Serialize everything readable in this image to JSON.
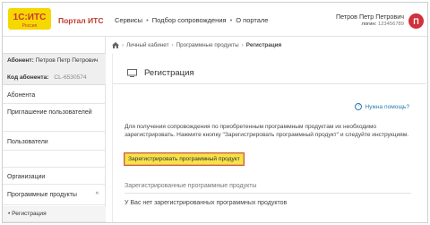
{
  "header": {
    "logo": {
      "brand_text": "1С:ИТС",
      "sub_text": "Россия"
    },
    "portal_title": "Портал ИТС",
    "nav": [
      "Сервисы",
      "Подбор сопровождения",
      "О портале"
    ],
    "user": {
      "name": "Петров Петр Петрович",
      "login_label": "логин:",
      "login_value": "123456789",
      "avatar_letter": "П"
    }
  },
  "sidebar": {
    "subscriber_label": "Абонент:",
    "subscriber_name": "Петров Петр Петрович",
    "code_label": "Код абонента:",
    "code_value": "CL-6530574",
    "items": [
      "Абонента",
      "Приглашение пользователей",
      "Пользователи",
      "Организации",
      "Программные продукты",
      "Регистрация"
    ]
  },
  "breadcrumb": {
    "items": [
      "Личный кабинет",
      "Программные продукты"
    ],
    "current": "Регистрация"
  },
  "main": {
    "title": "Регистрация",
    "help_link": "Нужна помощь?",
    "description": "Для получения сопровождения по приобретенным программным продуктам их необходимо зарегистрировать. Нажмите кнопку \"Зарегистрировать программный продукт\" и следуйте инструкциям.",
    "register_button": "Зарегистрировать программный продукт",
    "section_title": "Зарегистрированные программные продукты",
    "empty_message": "У Вас нет зарегистрированных программных продуктов"
  },
  "colors": {
    "accent_red": "#d0313b",
    "button_yellow": "#f7e349",
    "link_blue": "#2a7ab0"
  }
}
